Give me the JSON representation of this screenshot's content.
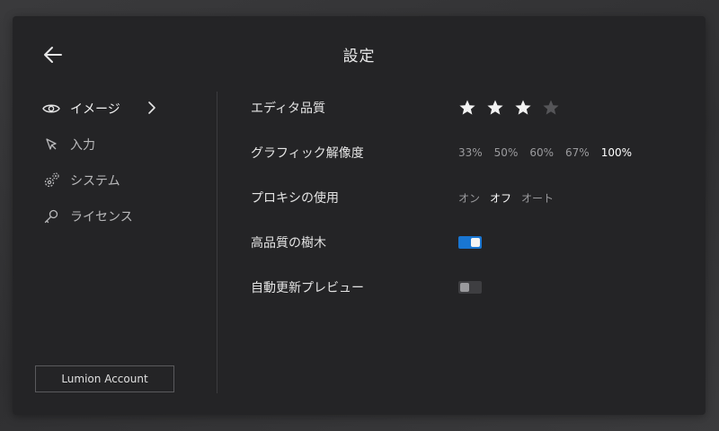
{
  "header": {
    "title": "設定"
  },
  "sidebar": {
    "items": [
      {
        "label": "イメージ",
        "icon": "eye-icon",
        "active": true
      },
      {
        "label": "入力",
        "icon": "cursor-icon",
        "active": false
      },
      {
        "label": "システム",
        "icon": "gears-icon",
        "active": false
      },
      {
        "label": "ライセンス",
        "icon": "key-icon",
        "active": false
      }
    ],
    "account_button": "Lumion Account"
  },
  "settings": {
    "editor_quality": {
      "label": "エディタ品質",
      "stars_total": 4,
      "stars_filled": 3
    },
    "graphic_resolution": {
      "label": "グラフィック解像度",
      "options": [
        "33%",
        "50%",
        "60%",
        "67%",
        "100%"
      ],
      "selected": "100%"
    },
    "proxy_use": {
      "label": "プロキシの使用",
      "options": [
        "オン",
        "オフ",
        "オート"
      ],
      "selected": "オフ"
    },
    "hq_trees": {
      "label": "高品質の樹木",
      "on": true
    },
    "auto_preview": {
      "label": "自動更新プレビュー",
      "on": false
    }
  },
  "colors": {
    "accent": "#1976d2",
    "panel": "#242426",
    "star_filled": "#f2f2f2",
    "star_empty": "#555558"
  }
}
